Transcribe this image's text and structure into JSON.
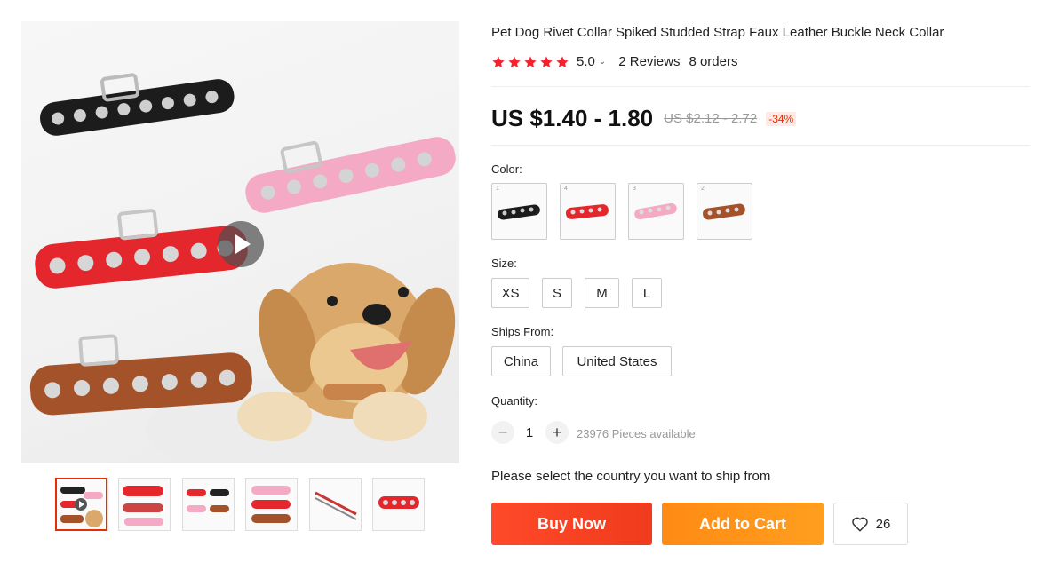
{
  "product": {
    "title": "Pet Dog Rivet Collar Spiked Studded Strap Faux Leather Buckle Neck Collar",
    "rating": "5.0",
    "reviews": "2 Reviews",
    "orders": "8 orders",
    "price": "US $1.40 - 1.80",
    "old_price": "US $2.12 - 2.72",
    "discount": "-34%"
  },
  "colors": {
    "accent": "#e62e04",
    "buy_now": "#f03c1c",
    "add_to_cart": "#ff9a1e",
    "star": "#f5222d"
  },
  "options": {
    "color_label": "Color:",
    "color_swatches": [
      {
        "num": "1",
        "icon": "black-collar-swatch"
      },
      {
        "num": "4",
        "icon": "red-collar-swatch"
      },
      {
        "num": "3",
        "icon": "pink-collar-swatch"
      },
      {
        "num": "2",
        "icon": "brown-collar-swatch"
      }
    ],
    "size_label": "Size:",
    "sizes": [
      "XS",
      "S",
      "M",
      "L"
    ],
    "ships_from_label": "Ships From:",
    "ships_from": [
      "China",
      "United States"
    ]
  },
  "quantity": {
    "label": "Quantity:",
    "minus": "−",
    "plus": "+",
    "value": "1",
    "available": "23976 Pieces available"
  },
  "shipping_note": "Please select the country you want to ship from",
  "actions": {
    "buy_now": "Buy Now",
    "add_to_cart": "Add to Cart",
    "wishlist_count": "26"
  }
}
